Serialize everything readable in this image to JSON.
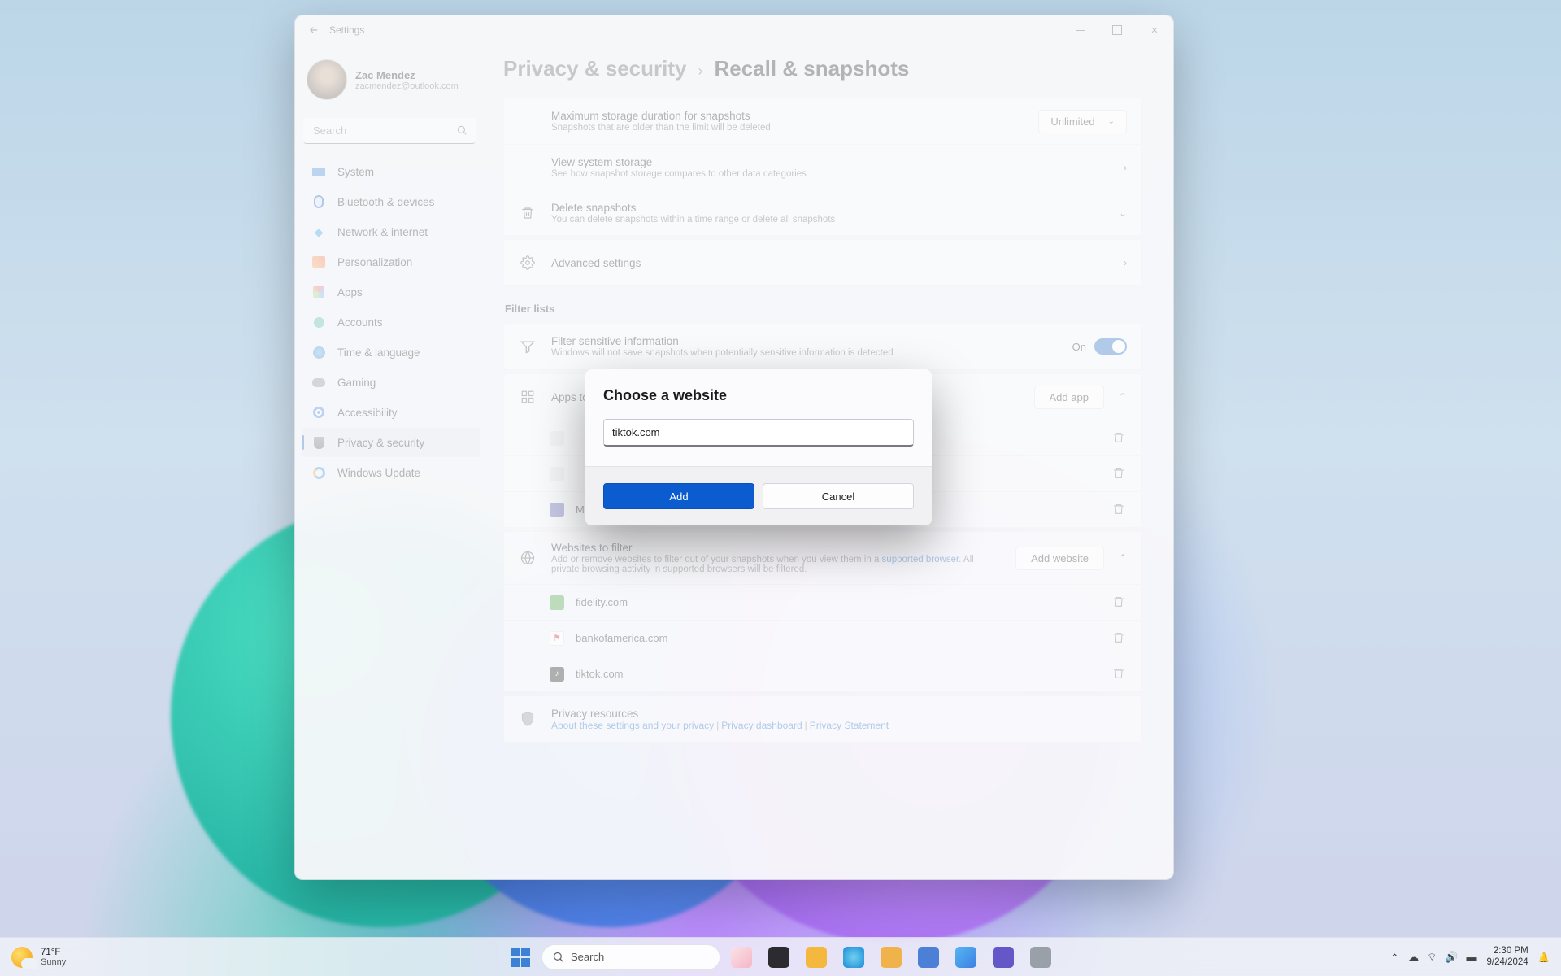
{
  "window": {
    "app_name": "Settings",
    "minimize": "–",
    "maximize": "□",
    "close": "✕"
  },
  "profile": {
    "name": "Zac Mendez",
    "email": "zacmendez@outlook.com"
  },
  "search": {
    "placeholder": "Search"
  },
  "nav": {
    "system": "System",
    "bluetooth": "Bluetooth & devices",
    "network": "Network & internet",
    "personalization": "Personalization",
    "apps": "Apps",
    "accounts": "Accounts",
    "time": "Time & language",
    "gaming": "Gaming",
    "accessibility": "Accessibility",
    "privacy": "Privacy & security",
    "windows_update": "Windows Update"
  },
  "breadcrumb": {
    "parent": "Privacy & security",
    "chev": "›",
    "current": "Recall & snapshots"
  },
  "storage": {
    "max_title": "Maximum storage duration for snapshots",
    "max_desc": "Snapshots that are older than the limit will be deleted",
    "max_value": "Unlimited",
    "view_title": "View system storage",
    "view_desc": "See how snapshot storage compares to other data categories",
    "delete_title": "Delete snapshots",
    "delete_desc": "You can delete snapshots within a time range or delete all snapshots",
    "advanced": "Advanced settings"
  },
  "filter": {
    "section": "Filter lists",
    "sensitive_title": "Filter sensitive information",
    "sensitive_desc": "Windows will not save snapshots when potentially sensitive information is detected",
    "sensitive_toggle_label": "On",
    "apps_title": "Apps to filter",
    "add_app": "Add app",
    "apps": {
      "teams": "Microsoft Teams"
    },
    "sites_title": "Websites to filter",
    "sites_desc_a": "Add or remove websites to filter out of your snapshots when you view them in a ",
    "sites_desc_link": "supported browser",
    "sites_desc_b": ". All private browsing activity in supported browsers will be filtered.",
    "add_website": "Add website",
    "sites": {
      "fidelity": "fidelity.com",
      "boa": "bankofamerica.com",
      "tiktok": "tiktok.com"
    },
    "privacy_title": "Privacy resources",
    "privacy_links": {
      "about": "About these settings and your privacy",
      "dashboard": "Privacy dashboard",
      "statement": "Privacy Statement"
    }
  },
  "dialog": {
    "title": "Choose a website",
    "value": "tiktok.com",
    "add": "Add",
    "cancel": "Cancel"
  },
  "taskbar": {
    "weather_temp": "71°F",
    "weather_cond": "Sunny",
    "search": "Search",
    "time": "2:30 PM",
    "date": "9/24/2024"
  }
}
